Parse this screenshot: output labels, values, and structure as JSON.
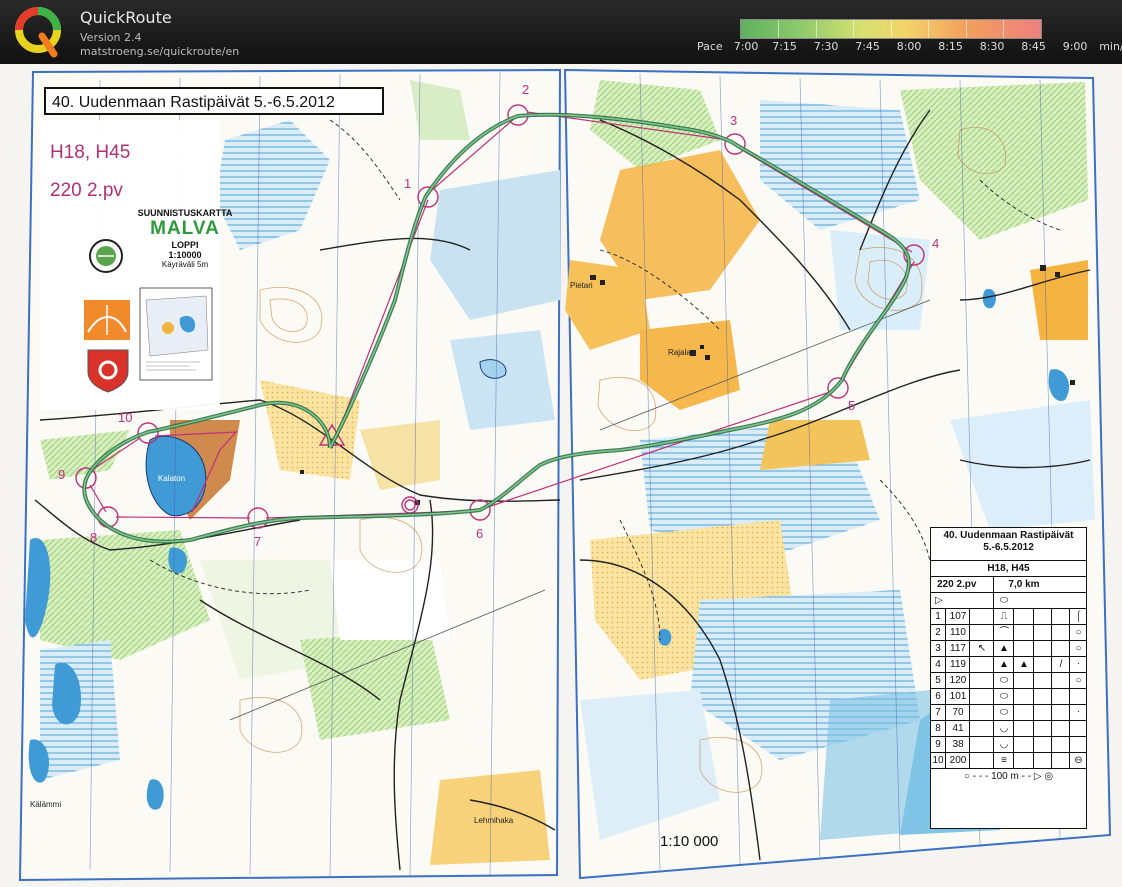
{
  "app": {
    "name": "QuickRoute",
    "version": "Version 2.4",
    "url": "matstroeng.se/quickroute/en"
  },
  "pace": {
    "label": "Pace",
    "ticks": [
      "7:00",
      "7:15",
      "7:30",
      "7:45",
      "8:00",
      "8:15",
      "8:30",
      "8:45",
      "9:00"
    ],
    "unit": "min/km",
    "colors": [
      "#5db160",
      "#8fca6c",
      "#d6e070",
      "#f4d36a",
      "#f2a05c",
      "#ee7f7f"
    ]
  },
  "map": {
    "title": "40. Uudenmaan Rastipäivät 5.-6.5.2012",
    "classes": "H18, H45",
    "course": "220 2.pv",
    "map_type": "SUUNNISTUSKARTTA",
    "map_name": "MALVA",
    "location": "LOPPI",
    "scale_small": "1:10000",
    "contour": "Käyräväli 5m",
    "scale_label": "1:10 000",
    "places": [
      "Pietari",
      "Rajala",
      "Kalaton",
      "Lehmihaka",
      "Kälämmi"
    ],
    "controls": [
      "1",
      "2",
      "3",
      "4",
      "5",
      "6",
      "7",
      "8",
      "9",
      "10"
    ],
    "colors": {
      "course": "#c0307a",
      "route": "#2f6f4a",
      "water": "#6ab5dc",
      "open": "#f5b342",
      "forest": "#ffffff"
    }
  },
  "control_description": {
    "title": "40. Uudenmaan Rastipäivät",
    "date": "5.-6.5.2012",
    "classes": "H18, H45",
    "course": "220 2.pv",
    "length": "7,0 km",
    "rows": [
      {
        "n": "1",
        "code": "107"
      },
      {
        "n": "2",
        "code": "110"
      },
      {
        "n": "3",
        "code": "117"
      },
      {
        "n": "4",
        "code": "119"
      },
      {
        "n": "5",
        "code": "120"
      },
      {
        "n": "6",
        "code": "101"
      },
      {
        "n": "7",
        "code": "70"
      },
      {
        "n": "8",
        "code": "41"
      },
      {
        "n": "9",
        "code": "38"
      },
      {
        "n": "10",
        "code": "200"
      }
    ],
    "finish": "100 m"
  }
}
